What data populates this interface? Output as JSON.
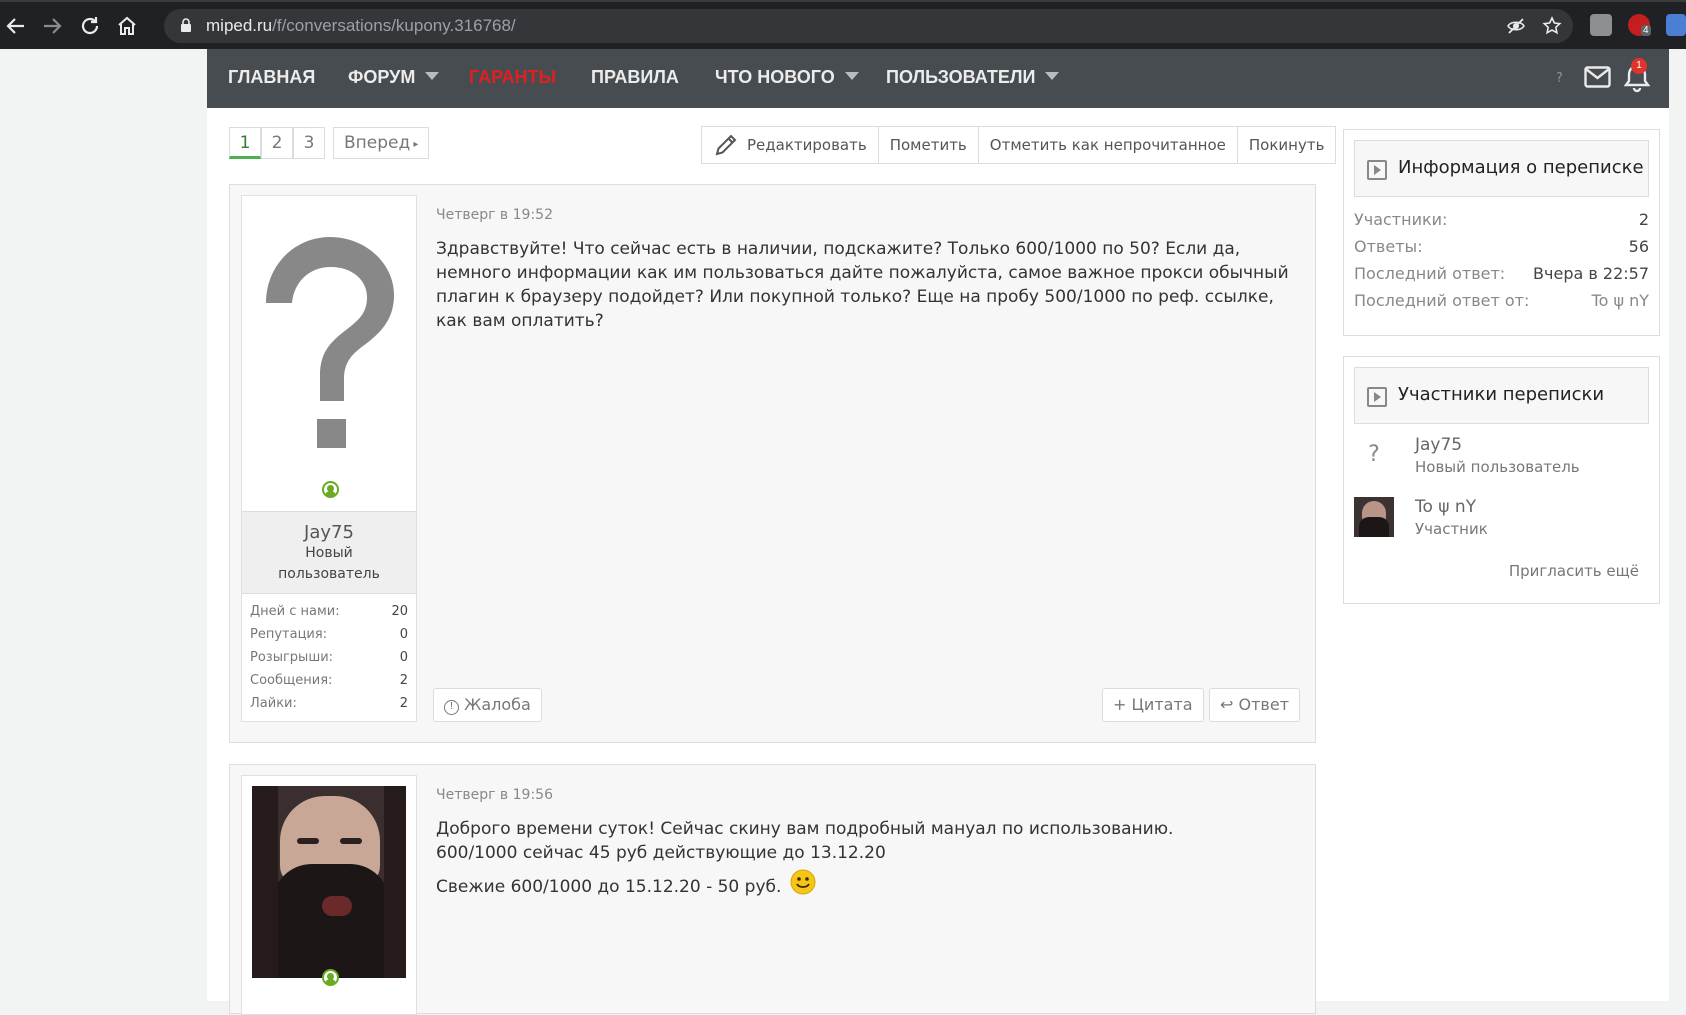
{
  "browser": {
    "url_host": "miped.ru",
    "url_path": "/f/conversations/kupony.316768/",
    "ext_badge": "4"
  },
  "nav": {
    "items": [
      "ГЛАВНАЯ",
      "ФОРУМ",
      "ГАРАНТЫ",
      "ПРАВИЛА",
      "ЧТО НОВОГО",
      "ПОЛЬЗОВАТЕЛИ"
    ],
    "help": "?",
    "bell_count": "1",
    "accent_red": "#e02020"
  },
  "pager": {
    "pages": [
      "1",
      "2",
      "3"
    ],
    "current": "1",
    "next": "Вперед"
  },
  "actions": {
    "edit": "Редактировать",
    "mark": "Пометить",
    "mark_unread": "Отметить как непрочитанное",
    "leave": "Покинуть"
  },
  "messages": [
    {
      "user": "Jay75",
      "title": "Новый пользователь",
      "date": "Четверг в 19:52",
      "stats": [
        {
          "label": "Дней с нами:",
          "value": "20"
        },
        {
          "label": "Репутация:",
          "value": "0"
        },
        {
          "label": "Розыгрыши:",
          "value": "0"
        },
        {
          "label": "Сообщения:",
          "value": "2"
        },
        {
          "label": "Лайки:",
          "value": "2"
        }
      ],
      "text": "Здравствуйте! Что сейчас есть в наличии, подскажите? Только 600/1000 по 50? Если да, немного информации как им пользоваться дайте пожалуйста, самое важное прокси обычный плагин к браузеру подойдет? Или покупной только? Еще на пробу 500/1000 по реф. ссылке, как вам оплатить?",
      "report": "Жалоба",
      "quote": "Цитата",
      "reply": "Ответ"
    },
    {
      "date": "Четверг в 19:56",
      "lines": [
        "Доброго времени суток! Сейчас скину вам подробный мануал по использованию.",
        "600/1000 сейчас 45 руб действующие до 13.12.20",
        "Свежие 600/1000 до 15.12.20 - 50 руб."
      ]
    }
  ],
  "sidebar": {
    "info_title": "Информация о переписке",
    "info_rows": [
      {
        "label": "Участники:",
        "value": "2"
      },
      {
        "label": "Ответы:",
        "value": "56"
      },
      {
        "label": "Последний ответ:",
        "value": "Вчера в 22:57"
      },
      {
        "label": "Последний ответ от:",
        "value": "To ψ nY"
      }
    ],
    "participants_title": "Участники переписки",
    "participants": [
      {
        "name": "Jay75",
        "title": "Новый пользователь",
        "avatar": "?"
      },
      {
        "name": "To ψ nY",
        "title": "Участник"
      }
    ],
    "invite": "Пригласить ещё"
  }
}
